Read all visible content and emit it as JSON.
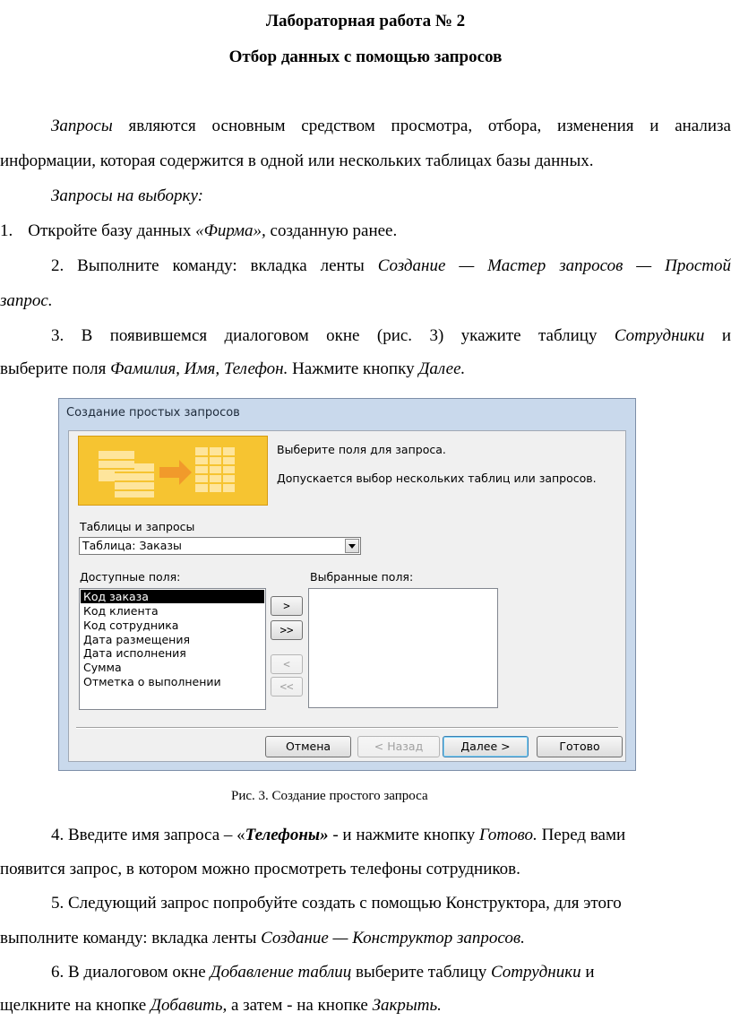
{
  "doc": {
    "title": "Лабораторная работа № 2",
    "subtitle": "Отбор данных с помощью запросов",
    "p1_a_italic": "Запросы",
    "p1_a_rest": " являются основным средством просмотра, отбора, изменения и анализа",
    "p1_b": "информации, которая содержится в одной или нескольких таблицах базы данных.",
    "p2": "Запросы на выборку:",
    "s1_num": "1.",
    "s1_pre": "Откройте базу данных ",
    "s1_italic": "«Фирма»,",
    "s1_post": " созданную ранее.",
    "s2_line1_pre": "2.   Выполните команду: вкладка ленты ",
    "s2_line1_italic": "Создание — Мастер запросов — Простой",
    "s2_line2_italic": "запрос.",
    "s3_line1_pre": "3.   В появившемся диалоговом окне (рис. 3) укажите таблицу ",
    "s3_line1_italic": "Сотрудники",
    "s3_line1_post": " и",
    "s3_line2_pre": "выберите поля ",
    "s3_line2_italic": "Фамилия, Имя, Телефон.",
    "s3_line2_mid": " Нажмите кнопку ",
    "s3_line2_italic2": "Далее.",
    "caption": "Рис. 3. Создание простого запроса",
    "s4_line1_pre": "4.   Введите имя запроса – «",
    "s4_line1_bi": "Телефоны»",
    "s4_line1_mid": " - и нажмите кнопку ",
    "s4_line1_italic": "Готово.",
    "s4_line1_post": " Перед вами",
    "s4_line2": "появится запрос, в котором можно просмотреть телефоны сотрудников.",
    "s5_line1": "5.   Следующий запрос попробуйте создать с помощью Конструктора, для этого",
    "s5_line2_pre": "выполните команду: вкладка ленты ",
    "s5_line2_italic": "Создание — Конструктор запросов.",
    "s6_line1_pre": "6.   В диалоговом окне ",
    "s6_line1_italic": "Добавление таблиц",
    "s6_line1_mid": " выберите таблицу ",
    "s6_line1_italic2": "Сотрудники",
    "s6_line1_post": " и",
    "s6_line2_pre": "щелкните на кнопке ",
    "s6_line2_italic": "Добавить,",
    "s6_line2_mid": " а затем - на кнопке ",
    "s6_line2_italic2": "Закрыть."
  },
  "dialog": {
    "title": "Создание простых запросов",
    "info1": "Выберите поля для запроса.",
    "info2": "Допускается выбор нескольких таблиц или запросов.",
    "tables_label": "Таблицы и запросы",
    "combo_value": "Таблица: Заказы",
    "available_label": "Доступные поля:",
    "selected_label": "Выбранные поля:",
    "available_fields": [
      "Код заказа",
      "Код клиента",
      "Код сотрудника",
      "Дата размещения",
      "Дата исполнения",
      "Сумма",
      "Отметка о выполнении"
    ],
    "btn_add": ">",
    "btn_add_all": ">>",
    "btn_remove": "<",
    "btn_remove_all": "<<",
    "btn_cancel": "Отмена",
    "btn_back": "< Назад",
    "btn_next": "Далее >",
    "btn_finish": "Готово",
    "accent": "#f6c431"
  }
}
